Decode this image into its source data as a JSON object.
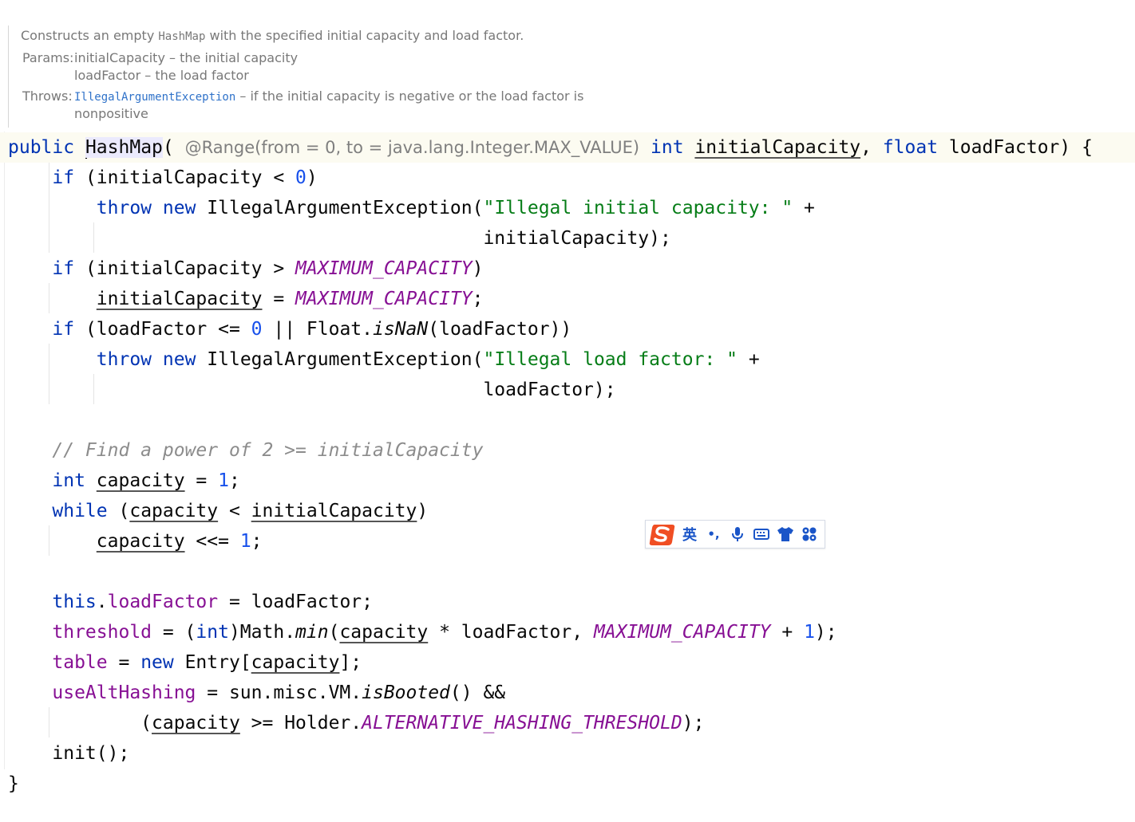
{
  "doc": {
    "summary_before": "Constructs an empty ",
    "summary_code": "HashMap",
    "summary_after": " with the specified initial capacity and load factor.",
    "params_label": "Params:",
    "param1": "initialCapacity – the initial capacity",
    "param2": "loadFactor – the load factor",
    "throws_label": "Throws:",
    "throws_link": "IllegalArgumentException",
    "throws_text": " – if the initial capacity is negative or the load factor is",
    "throws_cont": "nonpositive"
  },
  "code": {
    "sig_public": "public",
    "sig_name": "HashMap",
    "sig_open": "( ",
    "sig_anno": "@Range(from = 0, to = java.lang.Integer.MAX_VALUE)",
    "sig_int": "int",
    "sig_p1": "initialCapacity",
    "sig_comma": ", ",
    "sig_float": "float",
    "sig_p2": " loadFactor) {",
    "if": "if",
    "throw": "throw",
    "new": "new",
    "int": "int",
    "while": "while",
    "this": "this",
    "zero": "0",
    "one": "1",
    "l2_a": " (initialCapacity < ",
    "l2_b": ")",
    "l3_a": " IllegalArgumentException(",
    "l3_str": "\"Illegal initial capacity: \"",
    "l3_b": " +",
    "l4": "initialCapacity);",
    "l5_a": " (initialCapacity > ",
    "max_cap": "MAXIMUM_CAPACITY",
    "l5_b": ")",
    "init_cap": "initialCapacity",
    "l6_b": " = ",
    "semi": ";",
    "l7_a": " (loadFactor <= ",
    "l7_b": " || Float.",
    "isnan": "isNaN",
    "l7_c": "(loadFactor))",
    "l8_str": "\"Illegal load factor: \"",
    "l9": "loadFactor);",
    "comment": "// Find a power of 2 >= initialCapacity",
    "capacity": "capacity",
    "eq": " = ",
    "l12_a": " (",
    "l12_b": " < ",
    "l12_c": ")",
    "shift": " <<= ",
    "dot": ".",
    "load_factor_field": "loadFactor",
    "l15_b": " = loadFactor;",
    "threshold": "threshold",
    "l16_a": " = (",
    "l16_b": ")Math.",
    "min": "min",
    "paren_open": "(",
    "l16_c": " * loadFactor, ",
    "plus": " + ",
    "close_semi": ");",
    "table": "table",
    "l17_b": " Entry[",
    "l17_c": "];",
    "use_alt": "useAltHashing",
    "l18_b": " = sun.misc.VM.",
    "is_booted": "isBooted",
    "l18_c": "() &&",
    "l19_b": " >= Holder.",
    "alt_thresh": "ALTERNATIVE_HASHING_THRESHOLD",
    "l20": "init();",
    "close_brace": "}"
  },
  "ime": {
    "lang": "英",
    "punct": "•,",
    "icons": [
      "sogou-logo-icon",
      "microphone-icon",
      "keyboard-icon",
      "skin-shirt-icon",
      "toolbox-grid-icon"
    ],
    "accent": "#1a55c8",
    "logo_color": "#f04e23"
  }
}
